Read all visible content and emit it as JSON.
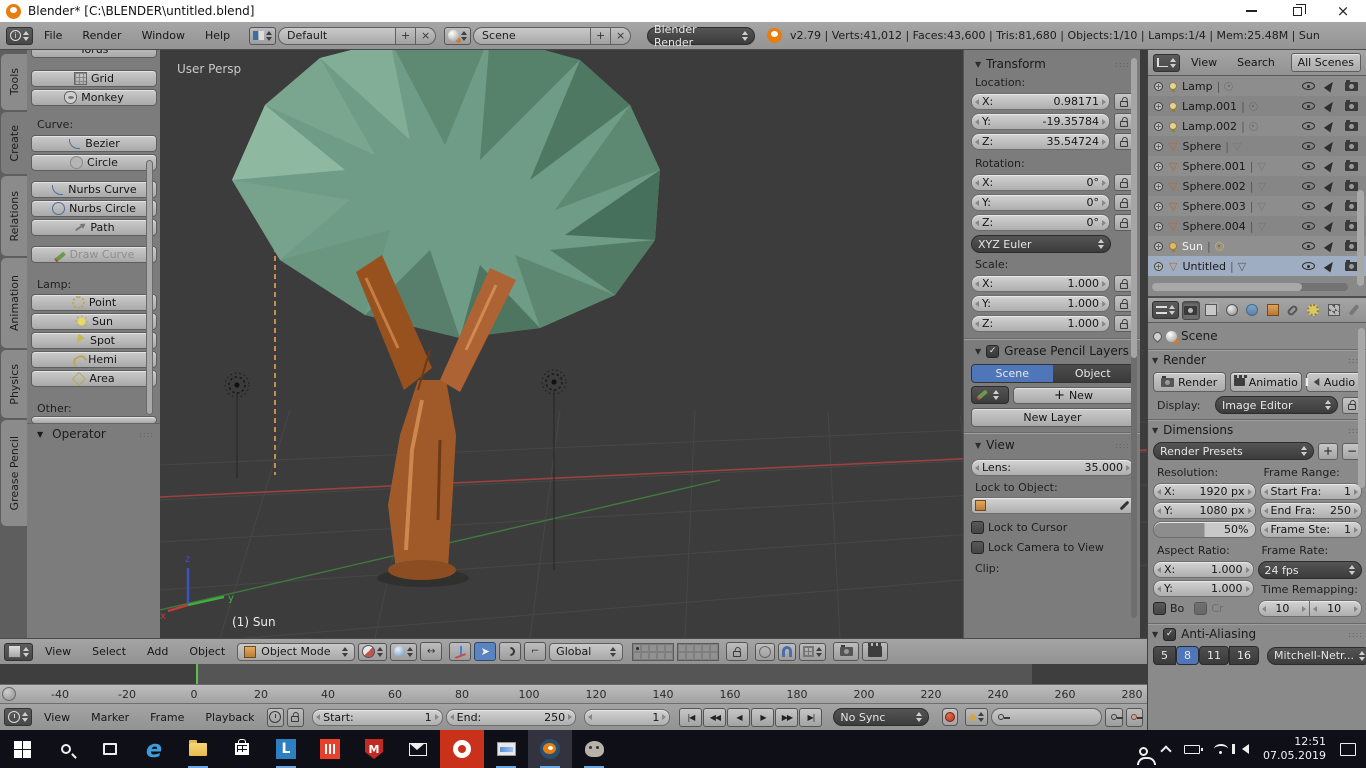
{
  "window": {
    "title": "Blender* [C:\\BLENDER\\untitled.blend]"
  },
  "infobar": {
    "menus": [
      "File",
      "Render",
      "Window",
      "Help"
    ],
    "layout": "Default",
    "scene": "Scene",
    "engine": "Blender Render",
    "stats": "v2.79 | Verts:41,012 | Faces:43,600 | Tris:81,680 | Objects:1/10 | Lamps:1/4 | Mem:25.48M | Sun"
  },
  "toolshelf": {
    "tabs": [
      "Tools",
      "Create",
      "Relations",
      "Animation",
      "Physics",
      "Grease Pencil"
    ],
    "torus": "Torus",
    "grid": "Grid",
    "monkey": "Monkey",
    "curve_label": "Curve:",
    "bezier": "Bezier",
    "circle": "Circle",
    "nurbs_curve": "Nurbs Curve",
    "nurbs_circle": "Nurbs Circle",
    "path": "Path",
    "draw_curve": "Draw Curve",
    "lamp_label": "Lamp:",
    "point": "Point",
    "sun": "Sun",
    "spot": "Spot",
    "hemi": "Hemi",
    "area": "Area",
    "other_label": "Other:",
    "operator": "Operator"
  },
  "viewport": {
    "view_label": "User Persp",
    "active_object": "(1) Sun",
    "axis_x": "x",
    "axis_y": "y",
    "axis_z": "z"
  },
  "npanel": {
    "transform": "Transform",
    "location_label": "Location:",
    "loc": {
      "x_label": "X:",
      "x": "0.98171",
      "y_label": "Y:",
      "y": "-19.35784",
      "z_label": "Z:",
      "z": "35.54724"
    },
    "rotation_label": "Rotation:",
    "rot": {
      "x_label": "X:",
      "x": "0°",
      "y_label": "Y:",
      "y": "0°",
      "z_label": "Z:",
      "z": "0°"
    },
    "rotation_mode": "XYZ Euler",
    "scale_label": "Scale:",
    "scl": {
      "x_label": "X:",
      "x": "1.000",
      "y_label": "Y:",
      "y": "1.000",
      "z_label": "Z:",
      "z": "1.000"
    },
    "gp": {
      "title": "Grease Pencil Layers",
      "scene_tab": "Scene",
      "object_tab": "Object",
      "new": "New",
      "new_layer": "New Layer"
    },
    "view": {
      "title": "View",
      "lens_label": "Lens:",
      "lens": "35.000",
      "lock_to_object": "Lock to Object:",
      "lock_to_cursor": "Lock to Cursor",
      "lock_camera": "Lock Camera to View",
      "clip": "Clip:"
    }
  },
  "outliner": {
    "menus": [
      "View",
      "Search"
    ],
    "filter": "All Scenes",
    "items": [
      {
        "name": "Lamp"
      },
      {
        "name": "Lamp.001"
      },
      {
        "name": "Lamp.002"
      },
      {
        "name": "Sphere"
      },
      {
        "name": "Sphere.001"
      },
      {
        "name": "Sphere.002"
      },
      {
        "name": "Sphere.003"
      },
      {
        "name": "Sphere.004"
      },
      {
        "name": "Sun"
      },
      {
        "name": "Untitled"
      }
    ]
  },
  "properties": {
    "context": "Scene",
    "render": {
      "title": "Render",
      "render_btn": "Render",
      "animation_btn": "Animatio",
      "audio_btn": "Audio",
      "display_label": "Display:",
      "display": "Image Editor"
    },
    "dimensions": {
      "title": "Dimensions",
      "presets": "Render Presets",
      "resolution_label": "Resolution:",
      "res_x_label": "X:",
      "res_x": "1920 px",
      "res_y_label": "Y:",
      "res_y": "1080 px",
      "res_pct": "50%",
      "frame_range_label": "Frame Range:",
      "start_label": "Start Fra:",
      "start": "1",
      "end_label": "End Fra:",
      "end": "250",
      "step_label": "Frame Ste:",
      "step": "1",
      "aspect_label": "Aspect Ratio:",
      "asp_x_label": "X:",
      "asp_x": "1.000",
      "asp_y_label": "Y:",
      "asp_y": "1.000",
      "fps_label": "Frame Rate:",
      "fps": "24 fps",
      "remap_label": "Time Remapping:",
      "remap_a": "10",
      "remap_b": "10",
      "border": "Bo",
      "crop": "Cr"
    },
    "aa": {
      "title": "Anti-Aliasing",
      "samples": [
        "5",
        "8",
        "11",
        "16"
      ],
      "filter": "Mitchell-Netr..."
    }
  },
  "view3d_header": {
    "menus": [
      "View",
      "Select",
      "Add",
      "Object"
    ],
    "mode": "Object Mode",
    "orientation": "Global"
  },
  "timeline": {
    "ticks": [
      "-40",
      "-20",
      "0",
      "20",
      "40",
      "60",
      "80",
      "100",
      "120",
      "140",
      "160",
      "180",
      "200",
      "220",
      "240",
      "260",
      "280"
    ],
    "menus": [
      "View",
      "Marker",
      "Frame",
      "Playback"
    ],
    "start_label": "Start:",
    "start": "1",
    "end_label": "End:",
    "end": "250",
    "current": "1",
    "sync": "No Sync"
  },
  "icons": {
    "rewind_start": "|◀",
    "prev_frame": "◀◀",
    "play_reverse": "◀",
    "play": "▶",
    "next_frame": "▶▶",
    "forward_end": "▶|",
    "keyframe_diamond": "◆",
    "collapse_arrow": "▼",
    "check": "✓",
    "plus": "+",
    "close_x": "×",
    "mesh_triangle": "▽",
    "expand_plus": "+"
  },
  "taskbar": {
    "time": "12:51",
    "date": "07.05.2019"
  }
}
